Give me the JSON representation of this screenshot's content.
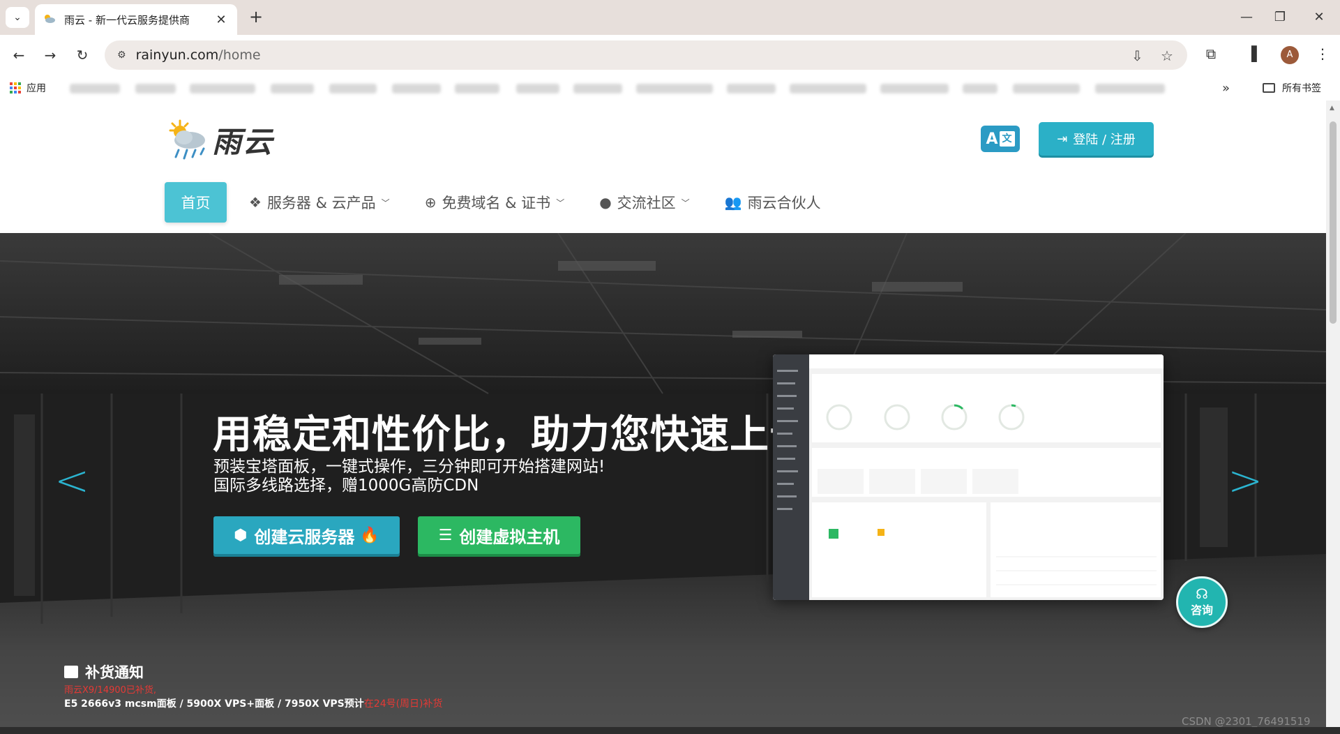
{
  "browser": {
    "tab_title": "雨云 - 新一代云服务提供商",
    "url_host": "rainyun.com",
    "url_path": "/home",
    "bookmarks_apps_label": "应用",
    "bookmarks_all_label": "所有书签"
  },
  "site": {
    "logo_text": "雨云",
    "login_label": "登陆 / 注册",
    "lang_label": "A"
  },
  "nav": {
    "home": "首页",
    "items": [
      {
        "label": "服务器 & 云产品",
        "icon": "cubes-icon"
      },
      {
        "label": "免费域名 & 证书",
        "icon": "globe-icon"
      },
      {
        "label": "交流社区",
        "icon": "comment-icon"
      },
      {
        "label": "雨云合伙人",
        "icon": "users-icon"
      }
    ]
  },
  "hero": {
    "title": "用稳定和性价比，助力您快速上云",
    "subtitle_1": "预装宝塔面板，一键式操作，三分钟即可开始搭建网站!",
    "subtitle_2": "国际多线路选择，赠1000G高防CDN",
    "btn_cloud": "创建云服务器",
    "btn_vhost": "创建虚拟主机"
  },
  "consult": {
    "label": "咨询"
  },
  "notice": {
    "title": "补货通知",
    "line1": "雨云X9/14900已补货,",
    "line2_main": "E5 2666v3 mcsm面板 / 5900X VPS+面板 / 7950X VPS预计",
    "line2_red": "在24号(周日)补货"
  },
  "watermark": "CSDN @2301_76491519",
  "colors": {
    "accent": "#2bb0c7",
    "green": "#2cb862",
    "nav_active": "#4cc3d4"
  }
}
